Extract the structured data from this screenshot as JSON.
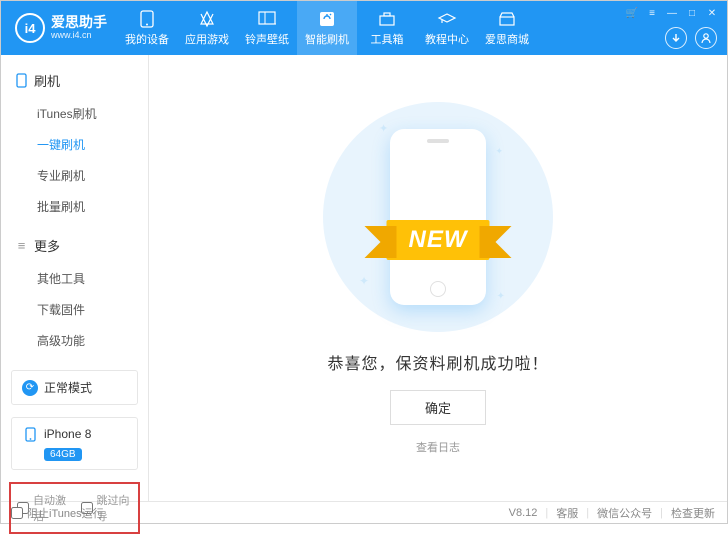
{
  "app": {
    "name": "爱思助手",
    "url": "www.i4.cn",
    "logo_text": "i4"
  },
  "nav": {
    "items": [
      {
        "label": "我的设备"
      },
      {
        "label": "应用游戏"
      },
      {
        "label": "铃声壁纸"
      },
      {
        "label": "智能刷机",
        "active": true
      },
      {
        "label": "工具箱"
      },
      {
        "label": "教程中心"
      },
      {
        "label": "爱思商城"
      }
    ]
  },
  "sidebar": {
    "section1": {
      "title": "刷机",
      "items": [
        {
          "label": "iTunes刷机"
        },
        {
          "label": "一键刷机",
          "active": true
        },
        {
          "label": "专业刷机"
        },
        {
          "label": "批量刷机"
        }
      ]
    },
    "section2": {
      "title": "更多",
      "items": [
        {
          "label": "其他工具"
        },
        {
          "label": "下载固件"
        },
        {
          "label": "高级功能"
        }
      ]
    },
    "mode": {
      "label": "正常模式"
    },
    "device": {
      "name": "iPhone 8",
      "storage": "64GB"
    },
    "opts": {
      "auto_activate": "自动激活",
      "skip_guide": "跳过向导"
    }
  },
  "content": {
    "ribbon": "NEW",
    "message": "恭喜您，保资料刷机成功啦！",
    "ok": "确定",
    "log": "查看日志"
  },
  "footer": {
    "block_itunes": "阻止iTunes运行",
    "version": "V8.12",
    "support": "客服",
    "wechat": "微信公众号",
    "update": "检查更新"
  }
}
